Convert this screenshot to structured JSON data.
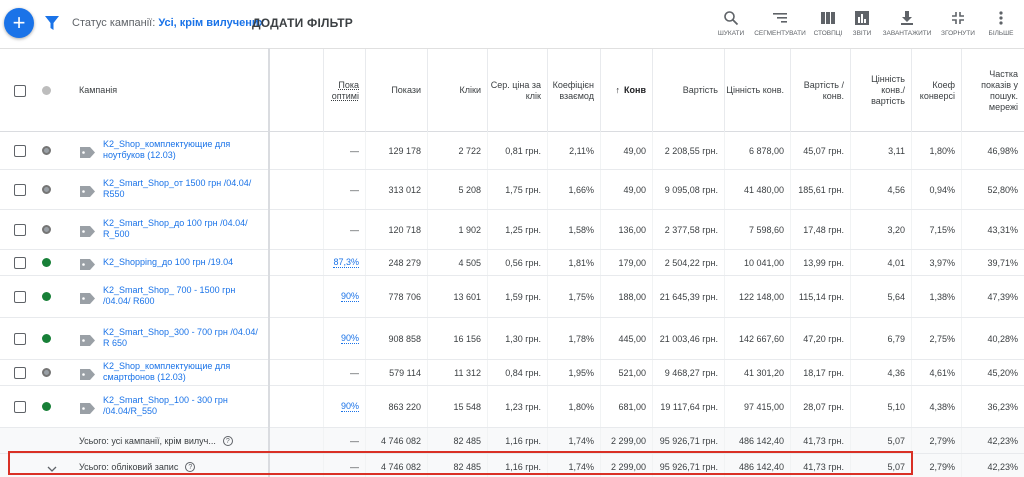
{
  "toolbar": {
    "filter_prefix": "Статус кампанії: ",
    "filter_value": "Усі, крім вилучених",
    "add_filter": "ДОДАТИ ФІЛЬТР",
    "tools": [
      {
        "label": "ШУКАТИ",
        "icon": "search-icon"
      },
      {
        "label": "СЕГМЕНТУВАТИ",
        "icon": "segment-icon"
      },
      {
        "label": "СТОВПЦІ",
        "icon": "columns-icon"
      },
      {
        "label": "ЗВІТИ",
        "icon": "reports-icon"
      },
      {
        "label": "ЗАВАНТАЖИТИ",
        "icon": "download-icon"
      },
      {
        "label": "ЗГОРНУТИ",
        "icon": "collapse-icon"
      },
      {
        "label": "БІЛЬШЕ",
        "icon": "more-icon"
      }
    ]
  },
  "columns": {
    "campaign": "Кампанія",
    "opt": "Пока оптимі",
    "impressions": "Покази",
    "clicks": "Кліки",
    "avg_cpc": "Сер. ціна за клік",
    "interaction_rate": "Коефіцієн взаємод",
    "conversions": "Конв",
    "cost": "Вартість",
    "conv_value": "Цінність конв.",
    "cost_per_conv": "Вартість / конв.",
    "value_per_cost": "Цінність конв./ вартість",
    "conv_rate": "Коеф конверсі",
    "search_share": "Частка показів у пошук. мережі"
  },
  "rows": [
    {
      "name": "K2_Shop_комплектующие для ноутбуков (12.03)",
      "status": "paused",
      "opt": "—",
      "impressions": "129 178",
      "clicks": "2 722",
      "avg_cpc": "0,81 грн.",
      "ir": "2,11%",
      "conv": "49,00",
      "cost": "2 208,55 грн.",
      "value": "6 878,00",
      "cpc_conv": "45,07 грн.",
      "vpc": "3,11",
      "cr": "1,80%",
      "share": "46,98%"
    },
    {
      "name": "K2_Smart_Shop_от 1500 грн /04.04/ R550",
      "status": "paused",
      "opt": "—",
      "impressions": "313 012",
      "clicks": "5 208",
      "avg_cpc": "1,75 грн.",
      "ir": "1,66%",
      "conv": "49,00",
      "cost": "9 095,08 грн.",
      "value": "41 480,00",
      "cpc_conv": "185,61 грн.",
      "vpc": "4,56",
      "cr": "0,94%",
      "share": "52,80%"
    },
    {
      "name": "K2_Smart_Shop_до 100 грн /04.04/ R_500",
      "status": "paused",
      "opt": "—",
      "impressions": "120 718",
      "clicks": "1 902",
      "avg_cpc": "1,25 грн.",
      "ir": "1,58%",
      "conv": "136,00",
      "cost": "2 377,58 грн.",
      "value": "7 598,60",
      "cpc_conv": "17,48 грн.",
      "vpc": "3,20",
      "cr": "7,15%",
      "share": "43,31%"
    },
    {
      "name": "K2_Shopping_до 100 грн /19.04",
      "status": "green",
      "opt": "87,3%",
      "impressions": "248 279",
      "clicks": "4 505",
      "avg_cpc": "0,56 грн.",
      "ir": "1,81%",
      "conv": "179,00",
      "cost": "2 504,22 грн.",
      "value": "10 041,00",
      "cpc_conv": "13,99 грн.",
      "vpc": "4,01",
      "cr": "3,97%",
      "share": "39,71%"
    },
    {
      "name": "K2_Smart_Shop_ 700 - 1500 грн /04.04/ R600",
      "status": "green",
      "opt": "90%",
      "impressions": "778 706",
      "clicks": "13 601",
      "avg_cpc": "1,59 грн.",
      "ir": "1,75%",
      "conv": "188,00",
      "cost": "21 645,39 грн.",
      "value": "122 148,00",
      "cpc_conv": "115,14 грн.",
      "vpc": "5,64",
      "cr": "1,38%",
      "share": "47,39%"
    },
    {
      "name": "K2_Smart_Shop_300 - 700 грн /04.04/ R 650",
      "status": "green",
      "opt": "90%",
      "impressions": "908 858",
      "clicks": "16 156",
      "avg_cpc": "1,30 грн.",
      "ir": "1,78%",
      "conv": "445,00",
      "cost": "21 003,46 грн.",
      "value": "142 667,60",
      "cpc_conv": "47,20 грн.",
      "vpc": "6,79",
      "cr": "2,75%",
      "share": "40,28%"
    },
    {
      "name": "K2_Shop_комплектующие для смартфонов (12.03)",
      "status": "paused",
      "opt": "—",
      "impressions": "579 114",
      "clicks": "11 312",
      "avg_cpc": "0,84 грн.",
      "ir": "1,95%",
      "conv": "521,00",
      "cost": "9 468,27 грн.",
      "value": "41 301,20",
      "cpc_conv": "18,17 грн.",
      "vpc": "4,36",
      "cr": "4,61%",
      "share": "45,20%"
    },
    {
      "name": "K2_Smart_Shop_100 - 300 грн /04.04/R_550",
      "status": "green",
      "opt": "90%",
      "impressions": "863 220",
      "clicks": "15 548",
      "avg_cpc": "1,23 грн.",
      "ir": "1,80%",
      "conv": "681,00",
      "cost": "19 117,64 грн.",
      "value": "97 415,00",
      "cpc_conv": "28,07 грн.",
      "vpc": "5,10",
      "cr": "4,38%",
      "share": "36,23%"
    }
  ],
  "totals": [
    {
      "label": "Усього: усі кампанії, крім вилуч...",
      "opt": "—",
      "impressions": "4 746 082",
      "clicks": "82 485",
      "avg_cpc": "1,16 грн.",
      "ir": "1,74%",
      "conv": "2 299,00",
      "cost": "95 926,71 грн.",
      "value": "486 142,40",
      "cpc_conv": "41,73 грн.",
      "vpc": "5,07",
      "cr": "2,79%",
      "share": "42,23%"
    },
    {
      "label": "Усього: обліковий запис",
      "opt": "—",
      "impressions": "4 746 082",
      "clicks": "82 485",
      "avg_cpc": "1,16 грн.",
      "ir": "1,74%",
      "conv": "2 299,00",
      "cost": "95 926,71 грн.",
      "value": "486 142,40",
      "cpc_conv": "41,73 грн.",
      "vpc": "5,07",
      "cr": "2,79%",
      "share": "42,23%"
    }
  ],
  "help_glyph": "?",
  "colors": {
    "accent": "#1a73e8",
    "active": "#188038",
    "highlight": "#d93025"
  }
}
